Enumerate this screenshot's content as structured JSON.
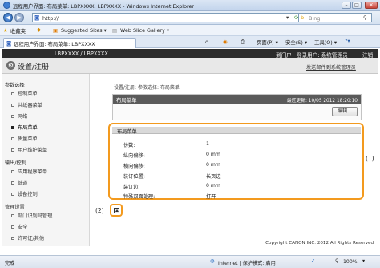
{
  "window": {
    "title": "远程用户界面: 布局菜单: LBPXXXX: LBPXXXX - Windows Internet Explorer"
  },
  "addressbar": {
    "url": "http://",
    "search_placeholder": "Bing"
  },
  "favorites": {
    "label": "收藏夹",
    "items": [
      "Suggested Sites ▾",
      "Web Slice Gallery ▾"
    ]
  },
  "tab": {
    "label": "远程用户界面: 布局菜单: LBPXXXX"
  },
  "commandbar": {
    "page": "页面(P) ▾",
    "safety": "安全(S) ▾",
    "tools": "工具(O) ▾",
    "help": "?▾"
  },
  "header": {
    "device": "LBPXXXX / LBPXXXX",
    "portal_link": "到门户",
    "login_user": "登录用户: 系统管理员",
    "logout": "注销"
  },
  "subheader": {
    "title": "设置/注册",
    "mail_link": "发送邮件到系统管理员"
  },
  "sidebar": {
    "sections": [
      {
        "title": "参数选择",
        "items": [
          "控制菜单",
          "共纸器菜单",
          "网络",
          "布局菜单",
          "质量菜单",
          "用户维护菜单"
        ]
      },
      {
        "title": "输出/控制",
        "items": [
          "应用程序菜单",
          "纸道",
          "设备控制"
        ]
      },
      {
        "title": "管理设置",
        "items": [
          "部门识别码管理",
          "安全",
          "许可证/其他"
        ]
      }
    ],
    "active": "布局菜单"
  },
  "main": {
    "breadcrumb": "设置/注册: 参数选择: 布局菜单",
    "panel_title": "布局菜单",
    "last_updated": "最近更新: 10/05 2012 18:20:10",
    "edit_button": "编辑...",
    "table_title": "布局菜单",
    "rows": [
      {
        "label": "份数:",
        "value": "1"
      },
      {
        "label": "纵向偏移:",
        "value": "0 mm"
      },
      {
        "label": "横向偏移:",
        "value": "0 mm"
      },
      {
        "label": "装订位置:",
        "value": "长页边"
      },
      {
        "label": "装订边:",
        "value": "0 mm"
      },
      {
        "label": "特殊双面处理:",
        "value": "打开"
      }
    ],
    "copyright": "Copyright CANON INC. 2012 All Rights Reserved"
  },
  "callouts": {
    "one": "(1)",
    "two": "(2)"
  },
  "statusbar": {
    "left": "完成",
    "zone": "Internet | 保护模式: 启用",
    "zoom": "100%"
  },
  "colors": {
    "highlight": "#f39a1e",
    "header_bg": "#2c2c2c",
    "panel_header": "#5a5a5a"
  }
}
